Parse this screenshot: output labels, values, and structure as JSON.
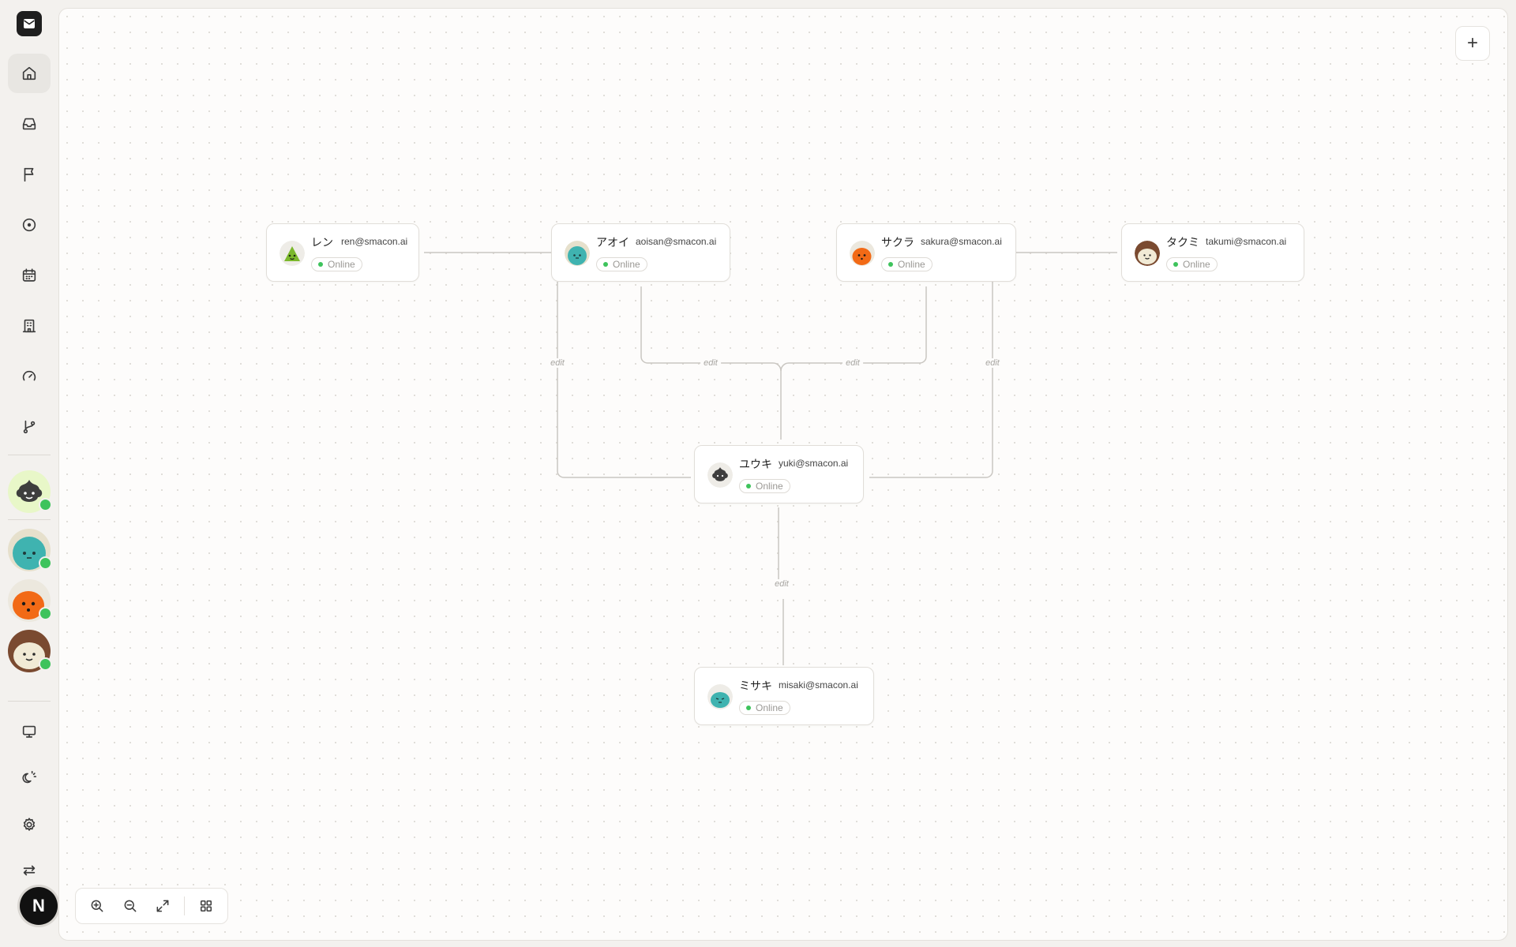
{
  "sidebar": {
    "nav": [
      {
        "icon": "home-icon",
        "active": true
      },
      {
        "icon": "inbox-icon"
      },
      {
        "icon": "flag-icon"
      },
      {
        "icon": "target-icon"
      },
      {
        "icon": "calendar-icon"
      },
      {
        "icon": "building-icon"
      },
      {
        "icon": "gauge-icon"
      },
      {
        "icon": "git-branch-icon"
      }
    ],
    "bottom_nav": [
      {
        "icon": "monitor-icon"
      },
      {
        "icon": "theme-icon"
      },
      {
        "icon": "gear-icon"
      },
      {
        "icon": "swap-icon"
      }
    ],
    "user_initial": "N"
  },
  "nodes": [
    {
      "id": "ren",
      "name": "レン",
      "email": "ren@smacon.ai",
      "status": "Online",
      "avatar_color": "#7bb82c"
    },
    {
      "id": "aoi",
      "name": "アオイ",
      "email": "aoisan@smacon.ai",
      "status": "Online",
      "avatar_color": "#3fb3b0"
    },
    {
      "id": "sakura",
      "name": "サクラ",
      "email": "sakura@smacon.ai",
      "status": "Online",
      "avatar_color": "#f26a16"
    },
    {
      "id": "takumi",
      "name": "タクミ",
      "email": "takumi@smacon.ai",
      "status": "Online",
      "avatar_color": "#7a4a30"
    },
    {
      "id": "yuki",
      "name": "ユウキ",
      "email": "yuki@smacon.ai",
      "status": "Online",
      "avatar_color": "#3c3c3c"
    },
    {
      "id": "misaki",
      "name": "ミサキ",
      "email": "misaki@smacon.ai",
      "status": "Online",
      "avatar_color": "#3fb3b0"
    }
  ],
  "edge_labels": [
    "edit",
    "edit",
    "edit",
    "edit",
    "edit"
  ],
  "colors": {
    "online": "#3ec35c",
    "accent_dark": "#1f1f1f"
  }
}
